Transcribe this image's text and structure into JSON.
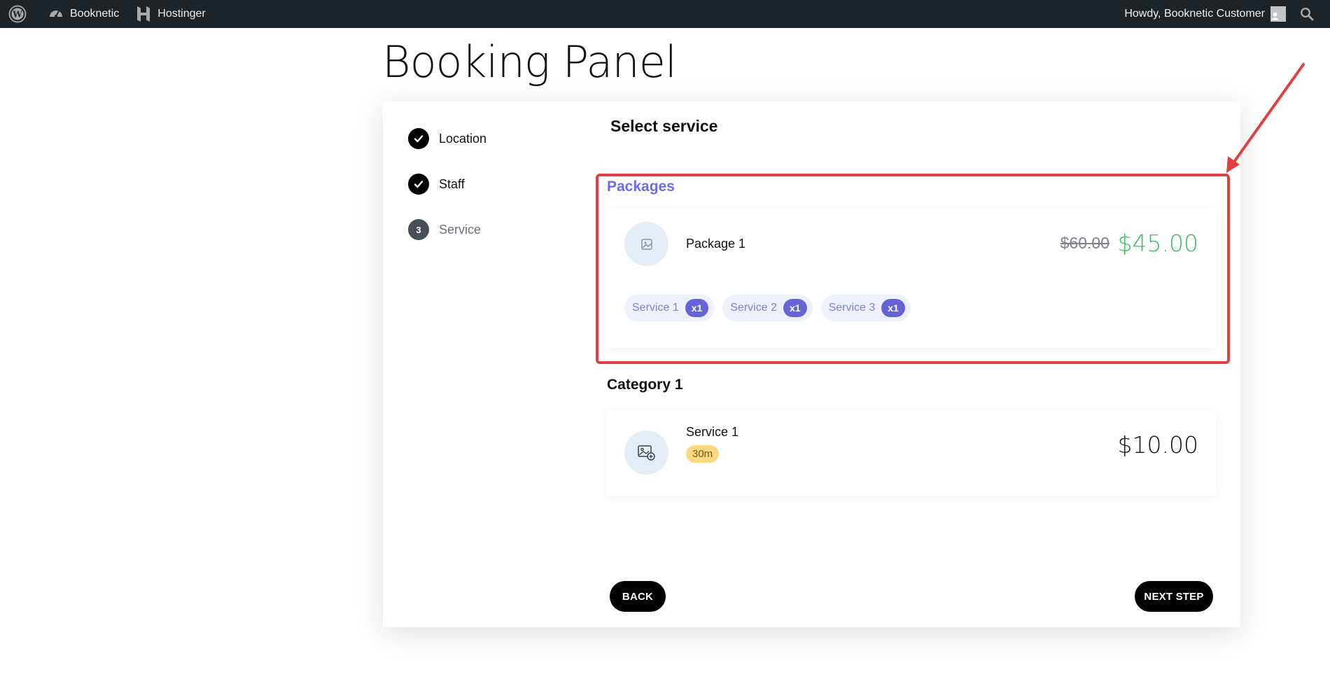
{
  "adminbar": {
    "items": [
      {
        "label": "Booknetic"
      },
      {
        "label": "Hostinger"
      }
    ],
    "greeting": "Howdy, Booknetic Customer"
  },
  "page": {
    "title": "Booking Panel"
  },
  "steps": [
    {
      "label": "Location",
      "state": "done"
    },
    {
      "label": "Staff",
      "state": "done"
    },
    {
      "label": "Service",
      "number": "3",
      "state": "current"
    }
  ],
  "section": {
    "title": "Select service"
  },
  "packages": {
    "title": "Packages",
    "items": [
      {
        "name": "Package 1",
        "old_price": "$60.00",
        "price": "$45.00",
        "services": [
          {
            "label": "Service 1",
            "qty": "x1"
          },
          {
            "label": "Service 2",
            "qty": "x1"
          },
          {
            "label": "Service 3",
            "qty": "x1"
          }
        ]
      }
    ]
  },
  "category": {
    "title": "Category 1",
    "items": [
      {
        "name": "Service 1",
        "duration": "30m",
        "price": "$10.00"
      }
    ]
  },
  "buttons": {
    "back": "BACK",
    "next": "NEXT STEP"
  },
  "colors": {
    "accent": "#6c6ce6",
    "price_green": "#3fba63",
    "highlight_red": "#e0403f",
    "duration_badge": "#fcd980",
    "adminbar": "#1d2327"
  }
}
